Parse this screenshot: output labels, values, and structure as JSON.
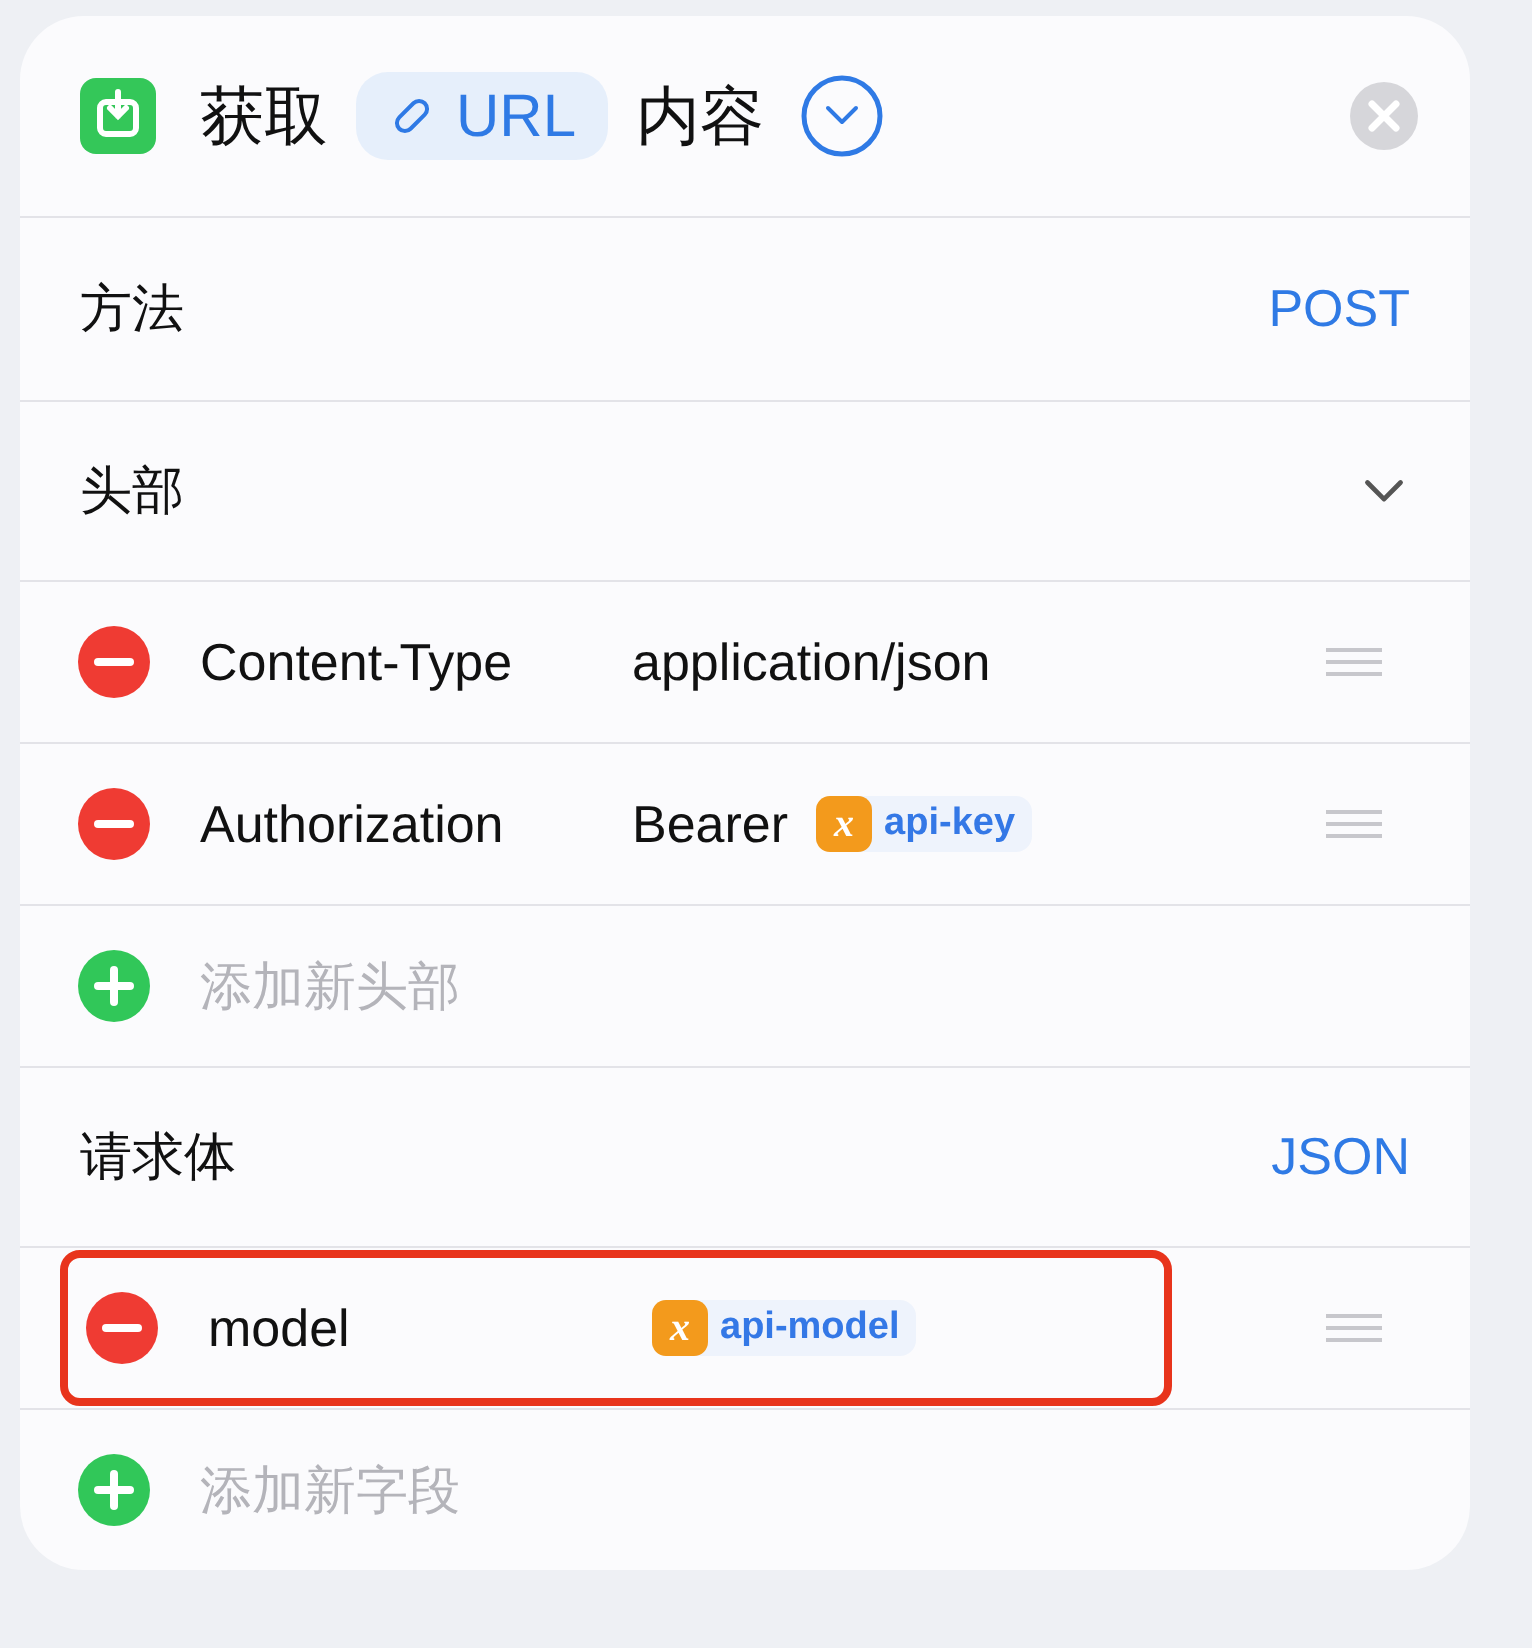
{
  "action": {
    "verb": "获取",
    "token": "URL",
    "noun": "内容",
    "expanded": false
  },
  "method": {
    "label": "方法",
    "value": "POST"
  },
  "headers": {
    "label": "头部",
    "expanded": true,
    "items": [
      {
        "key": "Content-Type",
        "value": "application/json"
      },
      {
        "key": "Authorization",
        "value": "Bearer",
        "variable": {
          "glyph": "x",
          "name": "api-key"
        }
      }
    ],
    "add": "添加新头部"
  },
  "body": {
    "label": "请求体",
    "value": "JSON",
    "fields": [
      {
        "key": "model",
        "variable": {
          "glyph": "x",
          "name": "api-model"
        },
        "highlighted": true
      }
    ],
    "add": "添加新字段"
  }
}
